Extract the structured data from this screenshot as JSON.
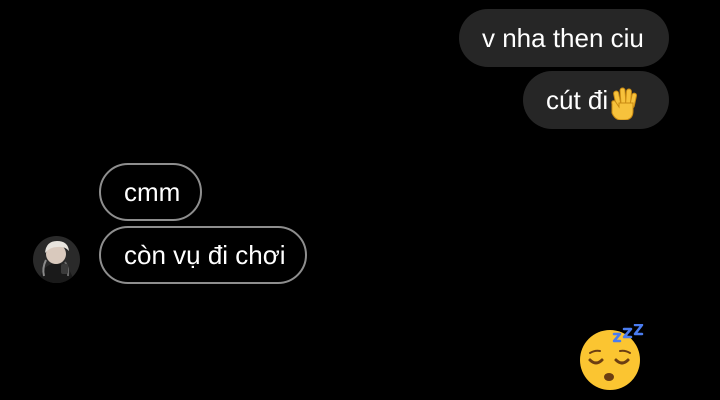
{
  "thread": {
    "messages": [
      {
        "sender": "me",
        "text": "v nha then ciu"
      },
      {
        "sender": "me",
        "text": "cút đi",
        "emoji": "raised-hand-icon"
      },
      {
        "sender": "other",
        "text": "cmm"
      },
      {
        "sender": "other",
        "text": "còn vụ đi chơi"
      }
    ],
    "reaction_emoji": "sleeping-face-icon"
  },
  "colors": {
    "background": "#000000",
    "sent_bubble": "#262626",
    "received_border": "#8e8e8e",
    "text": "#ffffff"
  }
}
